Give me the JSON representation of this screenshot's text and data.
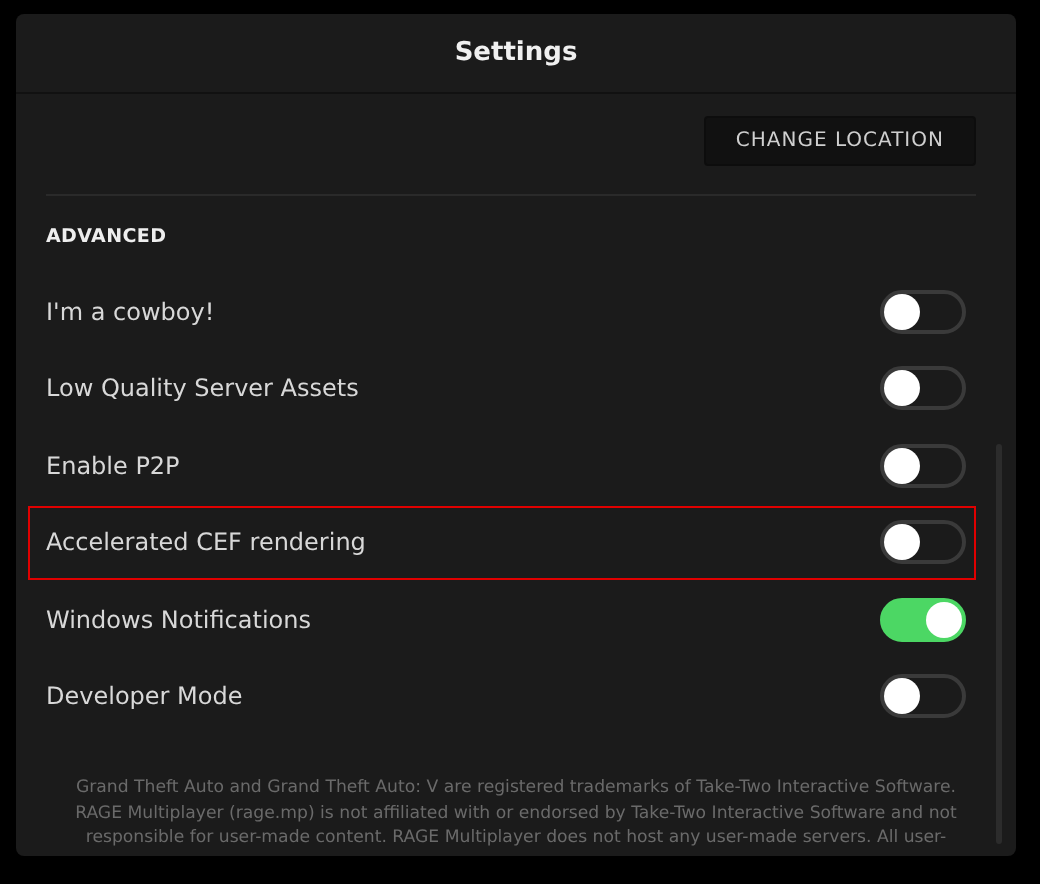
{
  "window": {
    "title": "Settings"
  },
  "location_button": {
    "label": "CHANGE LOCATION"
  },
  "section": {
    "title": "ADVANCED"
  },
  "settings": [
    {
      "label": "I'm a cowboy!",
      "on": false,
      "highlighted": false
    },
    {
      "label": "Low Quality Server Assets",
      "on": false,
      "highlighted": false
    },
    {
      "label": "Enable P2P",
      "on": false,
      "highlighted": false
    },
    {
      "label": "Accelerated CEF rendering",
      "on": false,
      "highlighted": true
    },
    {
      "label": "Windows Notifications",
      "on": true,
      "highlighted": false
    },
    {
      "label": "Developer Mode",
      "on": false,
      "highlighted": false
    }
  ],
  "footer": {
    "lines": [
      "Grand Theft Auto and Grand Theft Auto: V are registered trademarks of Take-Two Interactive Software.",
      "RAGE Multiplayer (rage.mp) is not affiliated with or endorsed by Take-Two Interactive Software and not",
      "responsible for user-made content. RAGE Multiplayer does not host any user-made servers. All user-"
    ]
  }
}
